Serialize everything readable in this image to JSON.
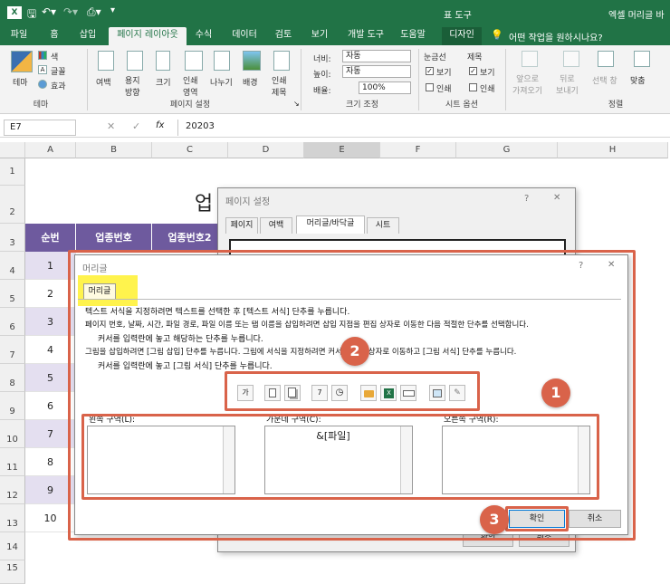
{
  "title": {
    "window": "엑셀 머리글 바",
    "tool_context": "표 도구"
  },
  "tabs": [
    "파일",
    "홈",
    "삽입",
    "페이지 레이아웃",
    "수식",
    "데이터",
    "검토",
    "보기",
    "개발 도구",
    "도움말",
    "디자인"
  ],
  "tell_me": "어떤 작업을 원하시나요?",
  "ribbon": {
    "theme": {
      "themes": "테마",
      "colors": "색",
      "fonts": "글꼴",
      "effects": "효과",
      "group": "테마"
    },
    "page_setup": {
      "margins": "여백",
      "orientation": "용지\n방향",
      "size": "크기",
      "print_area": "인쇄\n영역",
      "breaks": "나누기",
      "background": "배경",
      "print_titles": "인쇄\n제목",
      "group": "페이지 설정"
    },
    "scale": {
      "width_label": "너비:",
      "width_val": "자동",
      "height_label": "높이:",
      "height_val": "자동",
      "scale_label": "배율:",
      "scale_val": "100%",
      "group": "크기 조정"
    },
    "sheet_options": {
      "gridlines": "눈금선",
      "headings": "제목",
      "view": "보기",
      "print": "인쇄",
      "group": "시트 옵션"
    },
    "arrange": {
      "bring_forward": "앞으로\n가져오기",
      "send_backward": "뒤로\n보내기",
      "selection_pane": "선택 창",
      "align": "맞춤",
      "group": "정렬"
    }
  },
  "formula_bar": {
    "name_box": "E7",
    "fx": "fx",
    "value": "20203"
  },
  "columns": [
    "A",
    "B",
    "C",
    "D",
    "E",
    "F",
    "G",
    "H"
  ],
  "rows": [
    "1",
    "2",
    "3",
    "4",
    "5",
    "6",
    "7",
    "8",
    "9",
    "10",
    "11",
    "12",
    "13",
    "14",
    "15"
  ],
  "sheet": {
    "title_partial": "업",
    "header": [
      "순번",
      "업종번호",
      "업종번호2"
    ],
    "seq": [
      "1",
      "2",
      "3",
      "4",
      "5",
      "6",
      "7",
      "8",
      "9",
      "10"
    ]
  },
  "page_setup_dialog": {
    "title": "페이지 설정",
    "help": "?",
    "close": "✕",
    "tabs": [
      "페이지",
      "여백",
      "머리글/바닥글",
      "시트"
    ],
    "ok": "확인",
    "cancel": "취소"
  },
  "header_dialog": {
    "title": "머리글",
    "help": "?",
    "close": "✕",
    "tab": "머리글",
    "instructions": [
      "텍스트 서식을 지정하려면 텍스트를 선택한 후 [텍스트 서식] 단추를 누릅니다.",
      "페이지 번호, 날짜, 시간, 파일 경로, 파일 이름 또는 탭 이름을 삽입하려면 삽입 지점을 편집 상자로 이동한 다음 적절한 단추를 선택합니다.",
      "커서를 입력란에 놓고 해당하는 단추를 누릅니다.",
      "그림을 삽입하려면 [그림 삽입] 단추를 누릅니다.  그림에 서식을 지정하려면 커서를 편집 상자로 이동하고 [그림 서식] 단추를 누릅니다.",
      "커서를 입력란에 놓고 [그림 서식] 단추를 누릅니다."
    ],
    "left_label": "왼쪽 구역(L):",
    "center_label": "가운데 구역(C):",
    "right_label": "오른쪽 구역(R):",
    "center_value": "&[파일]",
    "ok": "확인",
    "cancel": "취소",
    "toolbar_buttons": [
      "format-text",
      "insert-page-number",
      "insert-page-count",
      "insert-date",
      "insert-time",
      "insert-file-path",
      "insert-file-name",
      "insert-sheet-name",
      "insert-picture",
      "format-picture"
    ]
  },
  "callouts": [
    "1",
    "2",
    "3"
  ],
  "colors": {
    "excel_green": "#217346",
    "callout_red": "#d9634a",
    "header_purple": "#6e5a9e",
    "row_lavender": "#e4dff0",
    "highlight_yellow": "#fff34d"
  }
}
